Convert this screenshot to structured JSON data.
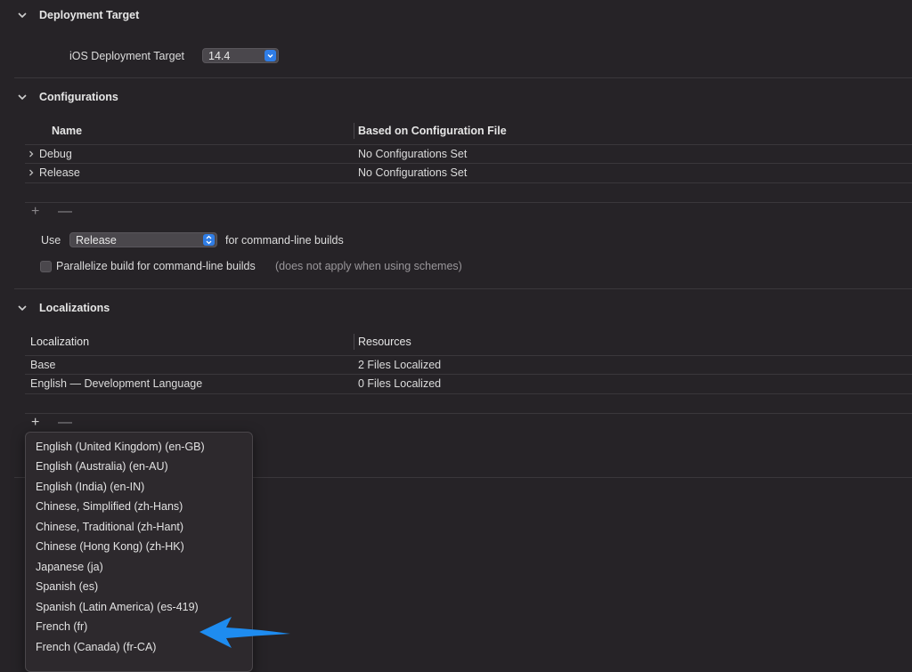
{
  "deployment": {
    "title": "Deployment Target",
    "ios_label": "iOS Deployment Target",
    "ios_value": "14.4"
  },
  "configurations": {
    "title": "Configurations",
    "columns": [
      "Name",
      "Based on Configuration File"
    ],
    "rows": [
      {
        "name": "Debug",
        "file": "No Configurations Set"
      },
      {
        "name": "Release",
        "file": "No Configurations Set"
      }
    ],
    "add_label": "+",
    "remove_label": "—",
    "use_label": "Use",
    "use_value": "Release",
    "use_suffix": "for command-line builds",
    "parallelize_label": "Parallelize build for command-line builds",
    "parallelize_note": "(does not apply when using schemes)"
  },
  "localizations": {
    "title": "Localizations",
    "columns": [
      "Localization",
      "Resources"
    ],
    "rows": [
      {
        "name": "Base",
        "resources": "2 Files Localized"
      },
      {
        "name": "English — Development Language",
        "resources": "0 Files Localized"
      }
    ],
    "add_label": "+",
    "remove_label": "—"
  },
  "language_menu": {
    "items": [
      "English (United Kingdom) (en-GB)",
      "English (Australia) (en-AU)",
      "English (India) (en-IN)",
      "Chinese, Simplified (zh-Hans)",
      "Chinese, Traditional (zh-Hant)",
      "Chinese (Hong Kong) (zh-HK)",
      "Japanese (ja)",
      "Spanish (es)",
      "Spanish (Latin America) (es-419)",
      "French (fr)",
      "French (Canada) (fr-CA)"
    ]
  },
  "annotation": {
    "arrow_color": "#1e8cf0",
    "points_to": "French (fr)"
  },
  "colors": {
    "background": "#262327",
    "accent": "#2f7de6"
  }
}
